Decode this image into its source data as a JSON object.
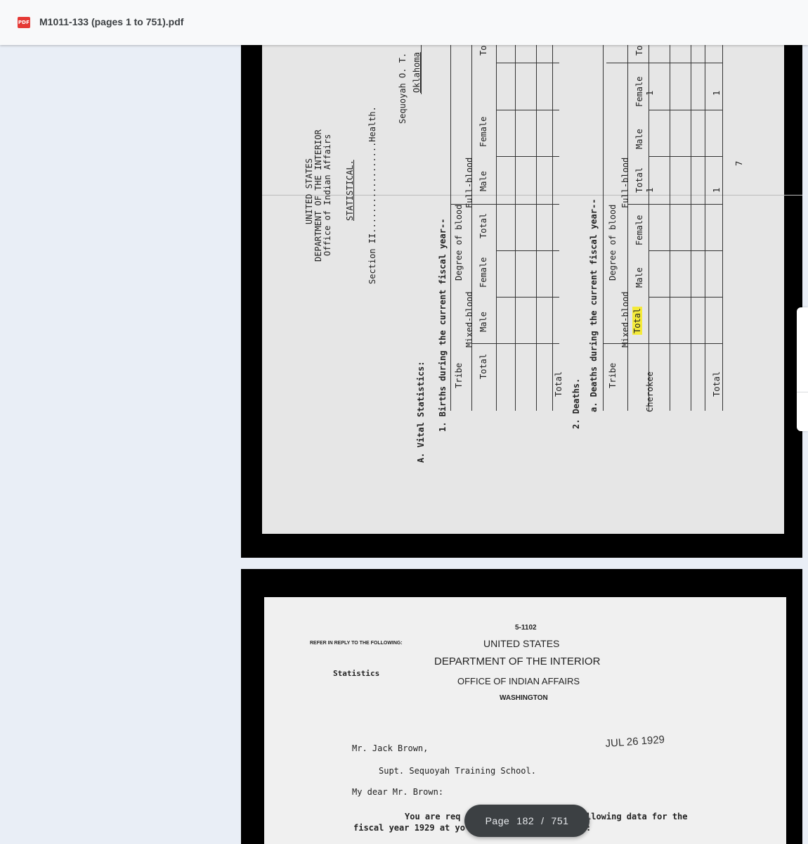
{
  "header": {
    "file_icon": "pdf-icon",
    "pdf_badge": "PDF",
    "title": "M1011-133 (pages 1 to 751).pdf"
  },
  "page1": {
    "agency_lines": [
      "UNITED STATES",
      "DEPARTMENT OF THE INTERIOR",
      "Office of Indian Affairs"
    ],
    "statistical": "STATISTICAL.",
    "section": "Section II..................Health.",
    "school": "Sequoyah O. T.",
    "state": "Oklahoma",
    "vital_stats": "A. Vital Statistics:",
    "births": "1. Births during the current fiscal year--",
    "deaths": "2. Deaths.",
    "deaths_sub": "a. Deaths during the current fiscal year--",
    "tribe": "Tribe",
    "degree_of_blood": "Degree of blood",
    "mixed_blood": "Mixed-blood",
    "full_blood": "Full-blood",
    "total": "Total",
    "male": "Male",
    "female": "Female",
    "total_cut": "To",
    "tribe_row": "Cherokee",
    "value_one": "1",
    "page_mark": "7"
  },
  "page2": {
    "form_number": "5-1102",
    "refer_line": "REFER IN REPLY TO THE FOLLOWING:",
    "refer_value": "Statistics",
    "agency1": "UNITED STATES",
    "agency2": "DEPARTMENT OF THE INTERIOR",
    "agency3": "OFFICE OF INDIAN AFFAIRS",
    "city": "WASHINGTON",
    "date_stamp": "JUL 26 1929",
    "addressee": "Mr. Jack Brown,",
    "addressee_title": "Supt. Sequoyah Training School.",
    "salutation": "My dear Mr. Brown:",
    "body_line1_start": "You are req",
    "body_line1_end": "llowing data for the",
    "body_line2_start": "fiscal year 1929 at yo",
    "body_line2_end": ":"
  },
  "pager": {
    "label": "Page",
    "current": "182",
    "separator": "/",
    "total": "751"
  }
}
